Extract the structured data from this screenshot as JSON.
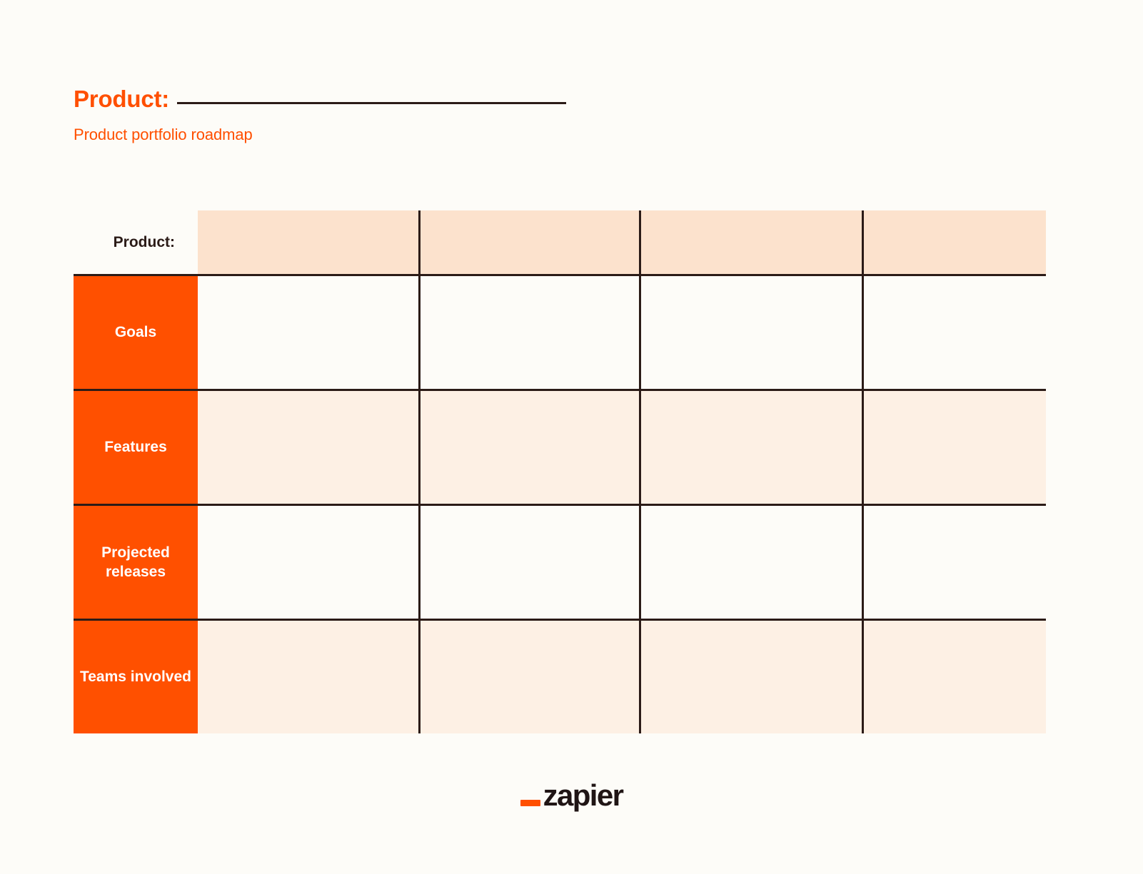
{
  "page": {
    "background_color": "#FDFCF8",
    "accent_color": "#FF4F00",
    "label_block_color": "#FF5000",
    "rule_color": "#2B1B17",
    "header_tint": "#FCE2CD",
    "row_tint": "#FDF0E4"
  },
  "header": {
    "title": "Product:",
    "subtitle": "Product portfolio roadmap"
  },
  "grid": {
    "header_row": {
      "label": "Product:",
      "columns": [
        "",
        "",
        "",
        ""
      ]
    },
    "rows": [
      {
        "label": "Goals",
        "cells": [
          "",
          "",
          "",
          ""
        ]
      },
      {
        "label": "Features",
        "cells": [
          "",
          "",
          "",
          ""
        ]
      },
      {
        "label": "Projected releases",
        "cells": [
          "",
          "",
          "",
          ""
        ]
      },
      {
        "label": "Teams involved",
        "cells": [
          "",
          "",
          "",
          ""
        ]
      }
    ]
  },
  "footer": {
    "logo_text": "zapier"
  }
}
